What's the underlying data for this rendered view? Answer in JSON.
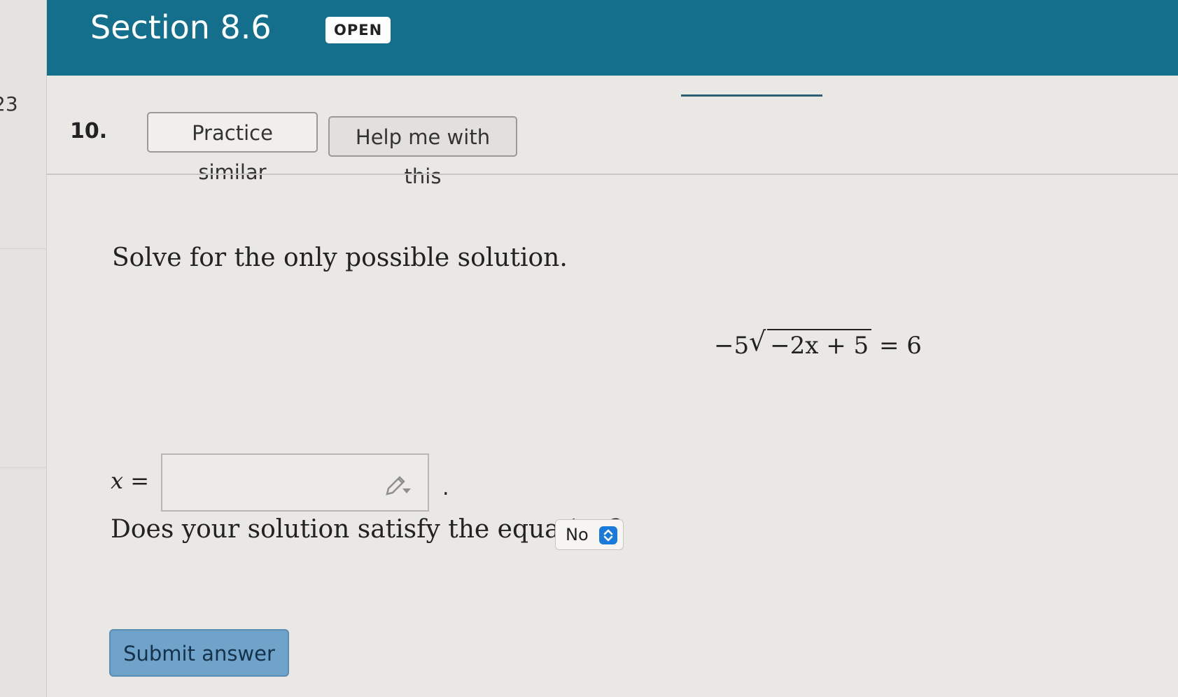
{
  "sidebar": {
    "partial_number": "23"
  },
  "header": {
    "title": "Section 8.6",
    "badge": "OPEN",
    "header_color": "#136f8b"
  },
  "question": {
    "number": "10.",
    "practice_button": "Practice similar",
    "help_button": "Help me with this",
    "prompt": "Solve for the only possible solution.",
    "equation": {
      "coefficient": "−5",
      "radicand": "−2x + 5",
      "rhs": "= 6"
    },
    "answer_label": "x =",
    "answer_value": "",
    "answer_period": ".",
    "satisfy_question": "Does your solution satisfy the equation?",
    "satisfy_selected": "No",
    "submit_button": "Submit answer"
  },
  "icons": {
    "answer_tool": "pencil-icon",
    "select_arrows": "chevron-updown-icon"
  }
}
